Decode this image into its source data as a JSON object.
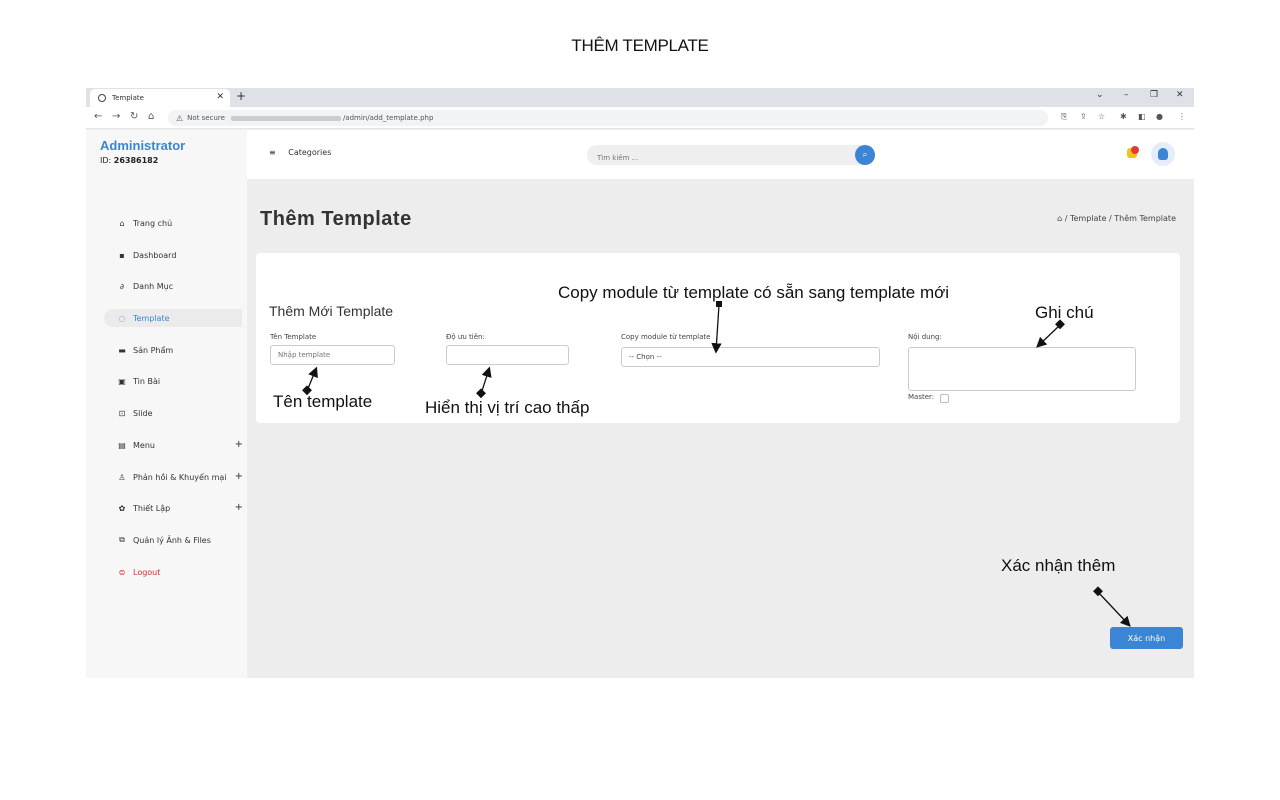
{
  "document": {
    "title": "THÊM TEMPLATE"
  },
  "browser": {
    "tab_title": "Template",
    "url_security": "Not secure",
    "url_path": "/admin/add_template.php"
  },
  "sidebar": {
    "admin_title": "Administrator",
    "admin_id_label": "ID:",
    "admin_id_value": "26386182",
    "items": [
      {
        "label": "Trang chủ",
        "icon": "home-icon"
      },
      {
        "label": "Dashboard",
        "icon": "grid-icon"
      },
      {
        "label": "Danh Mục",
        "icon": "link-icon"
      },
      {
        "label": "Template",
        "icon": "circle-icon",
        "active": true
      },
      {
        "label": "Sản Phẩm",
        "icon": "box-icon"
      },
      {
        "label": "Tin Bài",
        "icon": "news-icon"
      },
      {
        "label": "Slide",
        "icon": "slide-icon"
      },
      {
        "label": "Menu",
        "icon": "menu-icon",
        "expandable": true
      },
      {
        "label": "Phản hồi & Khuyến mại",
        "icon": "user-icon",
        "expandable": true
      },
      {
        "label": "Thiết Lập",
        "icon": "gear-icon",
        "expandable": true
      },
      {
        "label": "Quản lý Ảnh & Files",
        "icon": "images-icon"
      },
      {
        "label": "Logout",
        "icon": "logout-icon"
      }
    ]
  },
  "topbar": {
    "categories_label": "Categories",
    "search_placeholder": "Tìm kiếm ..."
  },
  "main": {
    "page_title": "Thêm Template",
    "breadcrumb": "⌂ / Template / Thêm Template",
    "form": {
      "title": "Thêm Mới Template",
      "name_label": "Tên Template",
      "name_placeholder": "Nhập template",
      "priority_label": "Độ ưu tiên:",
      "copy_label": "Copy module từ template",
      "copy_selected": "-- Chọn --",
      "content_label": "Nội dung:",
      "master_label": "Master:"
    },
    "confirm_button": "Xác nhận"
  },
  "annotations": {
    "copy_module": "Copy module từ template có sẵn sang template mới",
    "note": "Ghi chú",
    "template_name": "Tên template",
    "priority": "Hiển thị vị trí cao thấp",
    "confirm": "Xác nhận thêm"
  },
  "colors": {
    "accent": "#3a86d4",
    "logout": "#d63030",
    "page_bg": "#ededed"
  }
}
